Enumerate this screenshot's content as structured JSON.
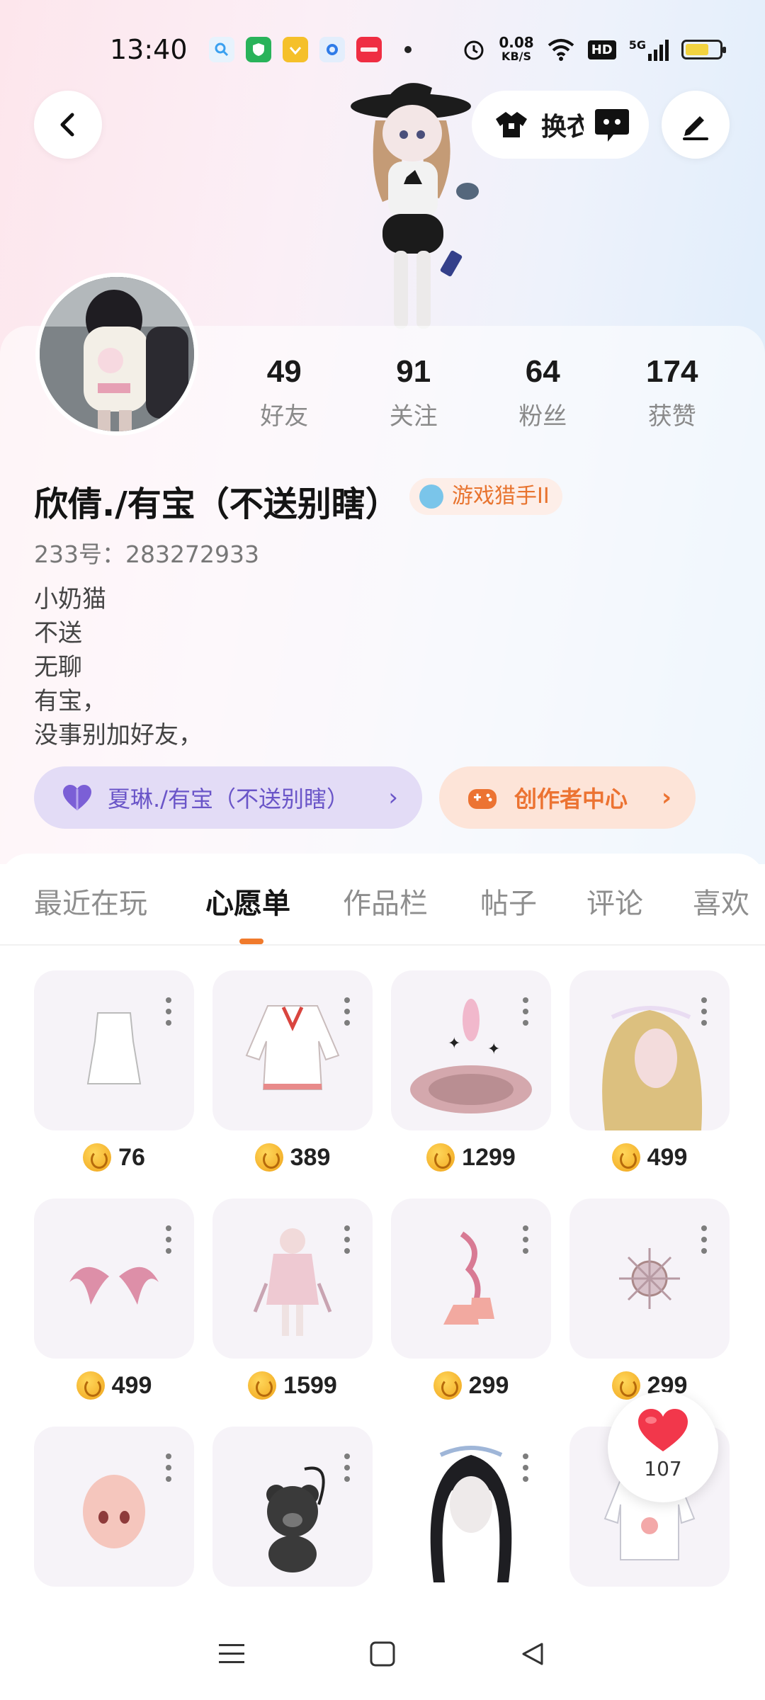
{
  "status_bar": {
    "time": "13:40",
    "net_speed_value": "0.08",
    "net_speed_unit": "KB/S",
    "hd_label": "HD",
    "signal_label": "5G",
    "battery_level": 0.7,
    "app_icons": [
      {
        "name": "search-app-icon",
        "color": "#3aa0f0"
      },
      {
        "name": "shield-app-icon",
        "color": "#29b35a"
      },
      {
        "name": "vpn-app-icon",
        "color": "#f5c02a"
      },
      {
        "name": "browser-app-icon",
        "color": "#2f7be8"
      },
      {
        "name": "xiaohongshu-app-icon",
        "color": "#ef2d42"
      }
    ]
  },
  "header": {
    "outfit_button_label": "换衣"
  },
  "profile": {
    "stats": [
      {
        "value": "49",
        "label": "好友"
      },
      {
        "value": "91",
        "label": "关注"
      },
      {
        "value": "64",
        "label": "粉丝"
      },
      {
        "value": "174",
        "label": "获赞"
      }
    ],
    "username": "欣倩./有宝（不送别瞎）",
    "badge_label": "游戏猎手II",
    "uid": "233号：283272933",
    "bio_lines": [
      "小奶猫",
      "不送",
      "无聊",
      "有宝，",
      "没事别加好友，"
    ],
    "friend_button_label": "夏琳./有宝（不送别瞎）",
    "creator_button_label": "创作者中心"
  },
  "tabs": [
    {
      "label": "最近在玩",
      "active": false
    },
    {
      "label": "心愿单",
      "active": true
    },
    {
      "label": "作品栏",
      "active": false
    },
    {
      "label": "帖子",
      "active": false
    },
    {
      "label": "评论",
      "active": false
    },
    {
      "label": "喜欢",
      "active": false
    }
  ],
  "wishlist": [
    {
      "name": "white-dress-thumb",
      "price": "76"
    },
    {
      "name": "sailor-dress-thumb",
      "price": "389"
    },
    {
      "name": "magic-circle-effect-thumb",
      "price": "1299"
    },
    {
      "name": "blonde-hair-thumb",
      "price": "499"
    },
    {
      "name": "pink-wings-thumb",
      "price": "499"
    },
    {
      "name": "pink-outfit-thumb",
      "price": "1599"
    },
    {
      "name": "pink-boots-thumb",
      "price": "299"
    },
    {
      "name": "halo-accessory-thumb",
      "price": "299"
    },
    {
      "name": "face-head-thumb",
      "price": ""
    },
    {
      "name": "bear-bag-thumb",
      "price": ""
    },
    {
      "name": "black-twin-hair-thumb",
      "price": ""
    },
    {
      "name": "hoodie-thumb",
      "price": ""
    }
  ],
  "floating_like": {
    "count": "107"
  },
  "icons": {
    "back": "chevron-left-icon",
    "outfit": "shirt-icon",
    "chat": "chat-bubble-icon",
    "edit": "pen-icon",
    "friend": "heart-icon",
    "creator": "gamepad-icon",
    "coin": "coin-icon",
    "like": "heart-icon"
  },
  "colors": {
    "accent": "#f07a2c",
    "friend_btn_bg": "#e3dcf6",
    "creator_btn_bg": "#fde4d8",
    "badge_text": "#e8742f"
  }
}
